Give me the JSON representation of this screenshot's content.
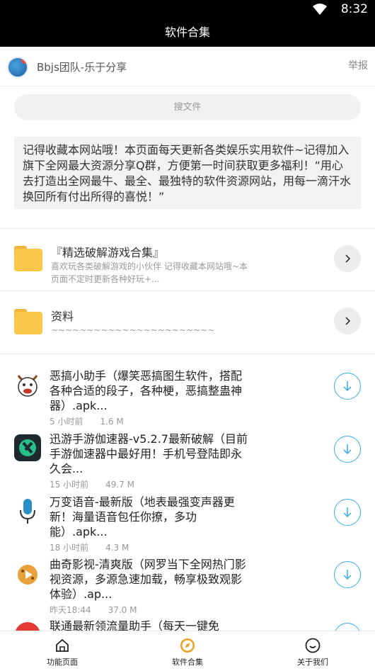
{
  "status": {
    "time": "8:32"
  },
  "header": {
    "title": "软件合集"
  },
  "profile": {
    "name": "Bbjs团队-乐于分享",
    "report_label": "举报"
  },
  "search": {
    "placeholder": "搜文件"
  },
  "notice": {
    "text": "记得收藏本网站哦！本页面每天更新各类娱乐实用软件~记得加入旗下全网最大资源分享Q群，方便第一时间获取更多福利！“用心去打造出全网最牛、最全、最独特的软件资源网站，用每一滴汗水换回所有付出所得的喜悦！”"
  },
  "folders": [
    {
      "title": "『精选破解游戏合集』",
      "desc": "喜欢玩各类破解游戏的小伙伴 记得收藏本网站哦~本页面不定时更新各种好玩+..."
    },
    {
      "title": "资料",
      "desc": "~~~~~~~~~~~~~~~~~~~~~~~"
    }
  ],
  "files": [
    {
      "name": "恶搞小助手（爆笑恶搞图生软件，搭配各种合适的段子，各种梗，恶搞整蛊神器）.apk...",
      "time": "5 小时前",
      "size": "1.6 M",
      "icon": "cow-face-icon"
    },
    {
      "name": "迅游手游伽速器-v5.2.7最新破解（目前手游伽速器中最好用！手机号登陆即永久会...",
      "time": "15 小时前",
      "size": "49.7 M",
      "icon": "xunyou-icon"
    },
    {
      "name": "万变语音-最新版（地表最强变声器更新！海量语音包任你撩，多功能）.apk...",
      "time": "18 小时前",
      "size": "4.3 M",
      "icon": "microphone-icon"
    },
    {
      "name": "曲奇影视-清爽版（网罗当下全网热门影视资源，多源急速加载，畅享极致观影体验）.ap...",
      "time": "昨天18:44",
      "size": "37.0 M",
      "icon": "cookie-play-icon"
    },
    {
      "name": "联通最新领流量助手（每天一键免",
      "time": "",
      "size": "",
      "icon": "unicom-icon"
    }
  ],
  "nav": [
    {
      "label": "功能页面",
      "icon": "home-icon"
    },
    {
      "label": "软件合集",
      "icon": "compass-icon",
      "accent": "#f0a020"
    },
    {
      "label": "关于我们",
      "icon": "smiley-icon"
    }
  ]
}
